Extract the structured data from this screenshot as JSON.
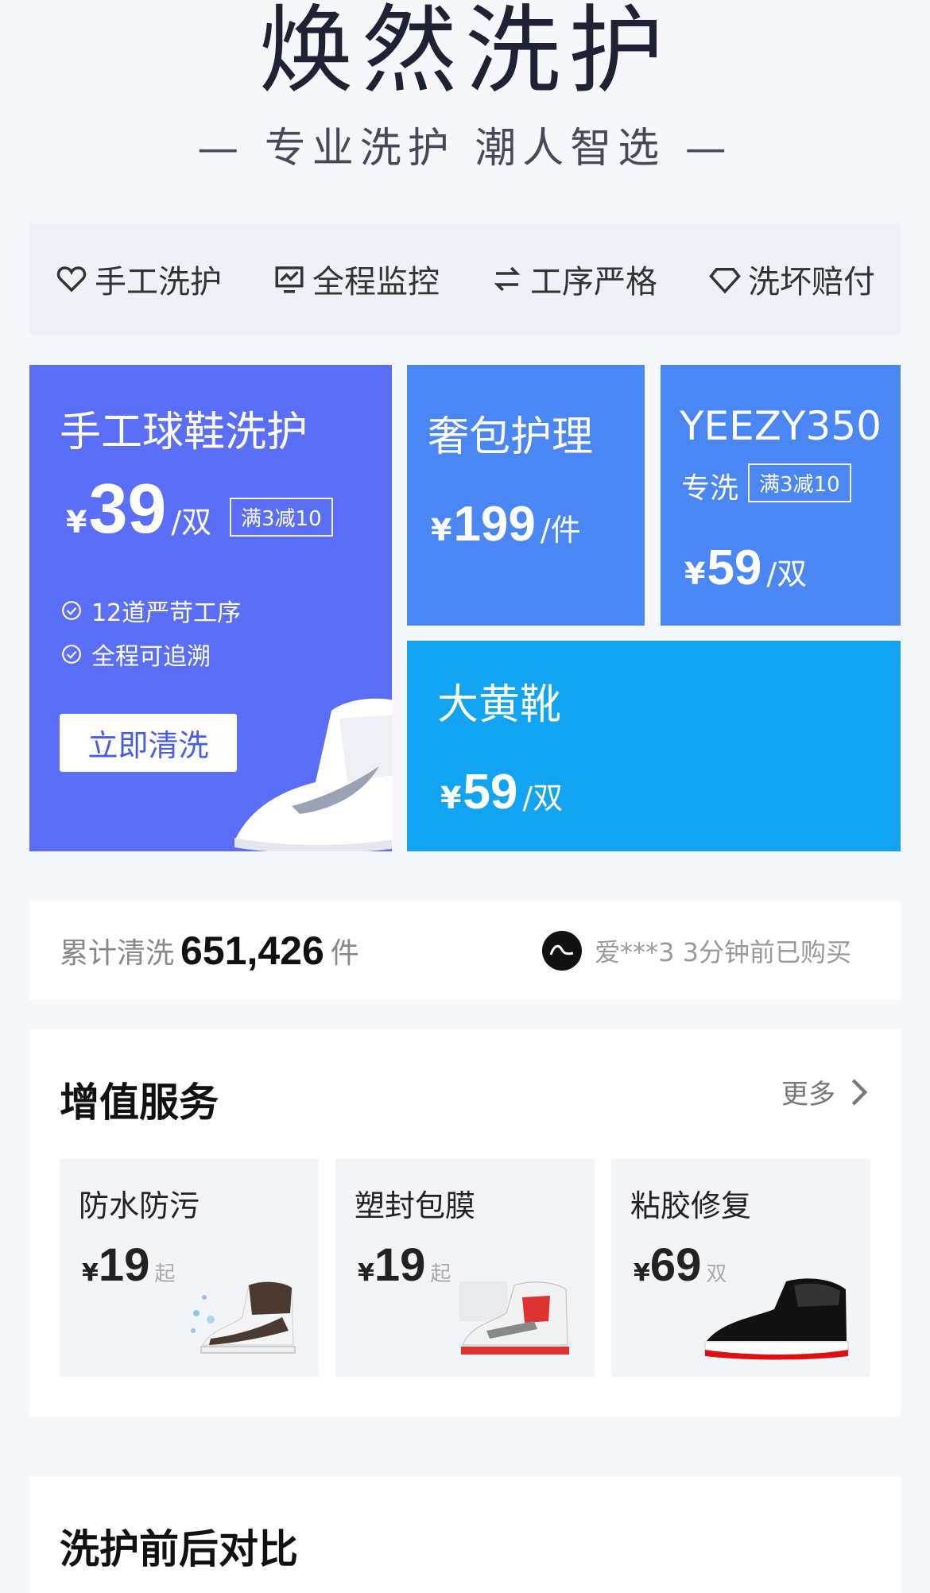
{
  "header": {
    "title": "焕然洗护",
    "subtitle": "— 专业洗护 潮人智选 —"
  },
  "features": [
    {
      "label": "手工洗护",
      "icon": "heart-icon"
    },
    {
      "label": "全程监控",
      "icon": "monitor-icon"
    },
    {
      "label": "工序严格",
      "icon": "swap-icon"
    },
    {
      "label": "洗坏赔付",
      "icon": "diamond-icon"
    }
  ],
  "tiles": {
    "sneaker": {
      "title": "手工球鞋洗护",
      "currency": "¥",
      "price": "39",
      "unit": "/双",
      "promo": "满3减10",
      "checks": [
        "12道严苛工序",
        "全程可追溯"
      ],
      "button": "立即清洗"
    },
    "bag": {
      "title": "奢包护理",
      "currency": "¥",
      "price": "199",
      "unit": "/件"
    },
    "yeezy": {
      "title": "YEEZY350",
      "subtitle": "专洗",
      "promo": "满3减10",
      "currency": "¥",
      "price": "59",
      "unit": "/双"
    },
    "timberland": {
      "title": "大黄靴",
      "currency": "¥",
      "price": "59",
      "unit": "/双"
    }
  },
  "stats": {
    "prefix": "累计清洗",
    "count": "651,426",
    "suffix": "件",
    "recent_purchase": "爱***3 3分钟前已购买"
  },
  "addons": {
    "title": "增值服务",
    "more": "更多",
    "items": [
      {
        "title": "防水防污",
        "currency": "¥",
        "price": "19",
        "suffix": "起"
      },
      {
        "title": "塑封包膜",
        "currency": "¥",
        "price": "19",
        "suffix": "起"
      },
      {
        "title": "粘胶修复",
        "currency": "¥",
        "price": "69",
        "suffix": "双"
      }
    ]
  },
  "compare": {
    "title": "洗护前后对比"
  },
  "colors": {
    "sneaker_tile": "#5b6ef7",
    "blue_tile": "#4a86f4",
    "cyan_tile": "#12a3f2",
    "page_bg": "#f5f7fa"
  }
}
